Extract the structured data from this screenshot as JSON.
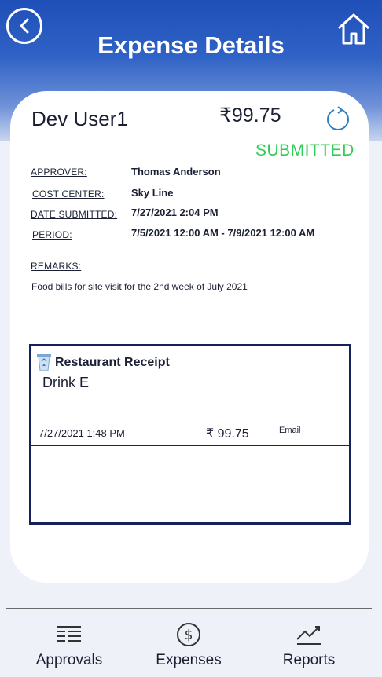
{
  "header": {
    "title": "Expense Details"
  },
  "expense": {
    "user": "Dev User1",
    "amount": "₹99.75",
    "status": "SUBMITTED",
    "status_color": "#2ecc54",
    "fields": [
      {
        "label": "APPROVER:",
        "value": "Thomas Anderson"
      },
      {
        "label": "COST CENTER:",
        "value": "Sky Line"
      },
      {
        "label": "DATE SUBMITTED:",
        "value": "7/27/2021 2:04 PM"
      },
      {
        "label": "PERIOD:",
        "value": "7/5/2021 12:00 AM - 7/9/2021 12:00 AM"
      }
    ],
    "remarks_label": "REMARKS:",
    "remarks": "Food bills for site visit for the 2nd week of July 2021"
  },
  "receipt": {
    "title": "Restaurant Receipt",
    "subtitle": "Drink E",
    "date": "7/27/2021 1:48 PM",
    "amount": "₹ 99.75",
    "email_label": "Email",
    "icon": "recycle-bin-icon"
  },
  "nav": [
    {
      "label": "Approvals",
      "icon": "list-icon"
    },
    {
      "label": "Expenses",
      "icon": "dollar-icon"
    },
    {
      "label": "Reports",
      "icon": "chart-icon"
    }
  ],
  "colors": {
    "header_blue": "#1f4fb8",
    "receipt_border": "#15215a",
    "icon_blue": "#2f7fc0"
  }
}
